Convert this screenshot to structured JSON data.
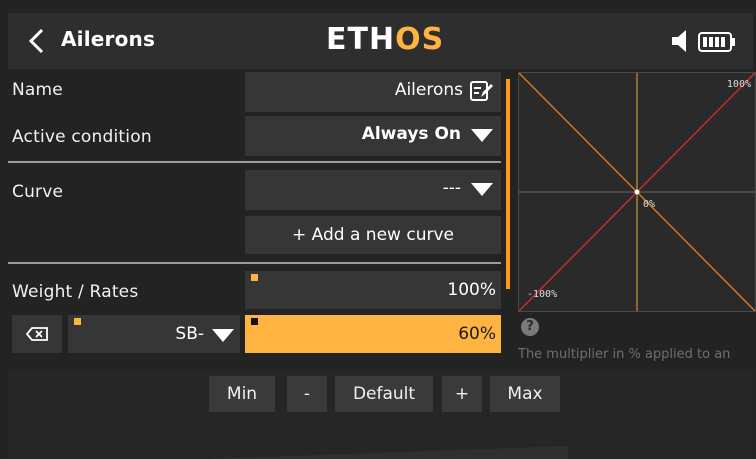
{
  "header": {
    "title": "Ailerons",
    "logo_main": "ETH",
    "logo_accent": "OS"
  },
  "form": {
    "name_label": "Name",
    "name_value": "Ailerons",
    "active_condition_label": "Active condition",
    "active_condition_value": "Always On",
    "curve_label": "Curve",
    "curve_value": "---",
    "add_curve_label": "+ Add a new curve",
    "weight_label": "Weight / Rates",
    "weight_value": "100%",
    "switch_value": "SB-",
    "rate_value": "60%"
  },
  "graph": {
    "top_right_label": "100%",
    "center_label": "0%",
    "bottom_left_label": "-100%"
  },
  "help": {
    "text": "The multiplier in % applied to an"
  },
  "buttons": {
    "min": "Min",
    "minus": "-",
    "default": "Default",
    "plus": "+",
    "max": "Max"
  },
  "colors": {
    "accent": "#ffb340",
    "highlight_field": "#ffb340",
    "graph_orange": "#e0781e",
    "graph_red": "#d42a2a",
    "graph_yellow": "#e8a93a"
  }
}
